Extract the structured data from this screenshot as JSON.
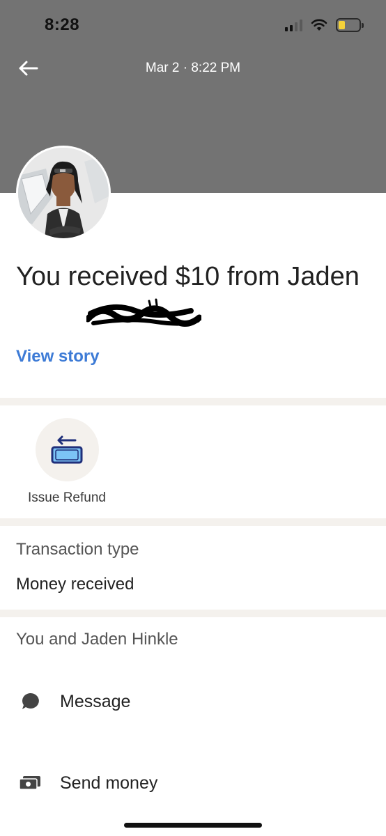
{
  "status_bar": {
    "time": "8:28",
    "battery_color": "#f5d23a"
  },
  "header": {
    "background": "#737373",
    "date_title": "Mar 2 · 8:22 PM",
    "back_icon": "arrow-left-icon"
  },
  "transaction": {
    "headline": "You received $10 from Jaden",
    "view_story_label": "View story",
    "link_color": "#3d7bd6"
  },
  "actions_primary": [
    {
      "label": "Issue Refund",
      "icon": "refund-icon"
    }
  ],
  "transaction_type": {
    "label": "Transaction type",
    "value": "Money received"
  },
  "contact_section": {
    "title": "You and Jaden Hinkle",
    "items": [
      {
        "label": "Message",
        "icon": "chat-bubble-icon"
      },
      {
        "label": "Send money",
        "icon": "cash-icon"
      }
    ]
  }
}
